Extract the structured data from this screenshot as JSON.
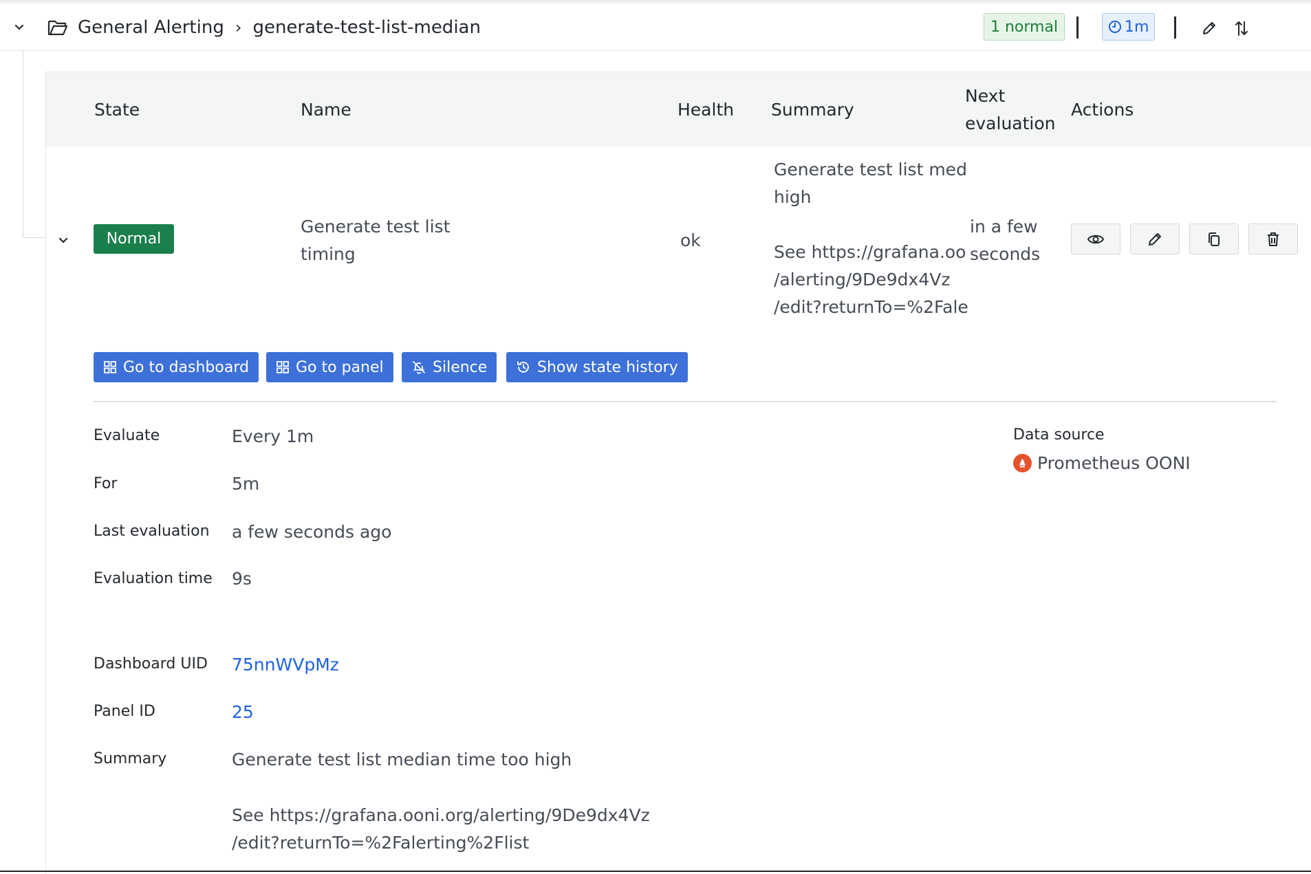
{
  "group": {
    "folder": "General Alerting",
    "separator": "›",
    "name": "generate-test-list-median",
    "state_count": "1 normal",
    "interval": "1m"
  },
  "table": {
    "headers": {
      "state": "State",
      "name": "Name",
      "health": "Health",
      "summary": "Summary",
      "next_eval_1": "Next",
      "next_eval_2": "evaluation",
      "actions": "Actions"
    },
    "row": {
      "state": "Normal",
      "name_line1": "Generate test list",
      "name_line2": "timing",
      "health": "ok",
      "summary_lines": [
        "Generate test list med",
        "high",
        "",
        "See https://grafana.oo",
        "/alerting/9De9dx4Vz",
        "/edit?returnTo=%2Fale"
      ],
      "next_eval_line1": "in a few",
      "next_eval_line2": "seconds"
    }
  },
  "buttons": {
    "dashboard": "Go to dashboard",
    "panel": "Go to panel",
    "silence": "Silence",
    "history": "Show state history"
  },
  "details": {
    "evaluate_label": "Evaluate",
    "evaluate_value": "Every 1m",
    "for_label": "For",
    "for_value": "5m",
    "last_eval_label": "Last evaluation",
    "last_eval_value": "a few seconds ago",
    "eval_time_label": "Evaluation time",
    "eval_time_value": "9s",
    "dashboard_uid_label": "Dashboard UID",
    "dashboard_uid_value": "75nnWVpMz",
    "panel_id_label": "Panel ID",
    "panel_id_value": "25",
    "summary_label": "Summary",
    "summary_line1": "Generate test list median time too high",
    "summary_line2": "See https://grafana.ooni.org/alerting/9De9dx4Vz",
    "summary_line3": "/edit?returnTo=%2Falerting%2Flist"
  },
  "datasource": {
    "label": "Data source",
    "name": "Prometheus OONI",
    "icon": "prometheus-icon"
  },
  "colors": {
    "normal_badge": "#1a7f4b",
    "primary": "#3d71d9",
    "link": "#1f62e0"
  }
}
